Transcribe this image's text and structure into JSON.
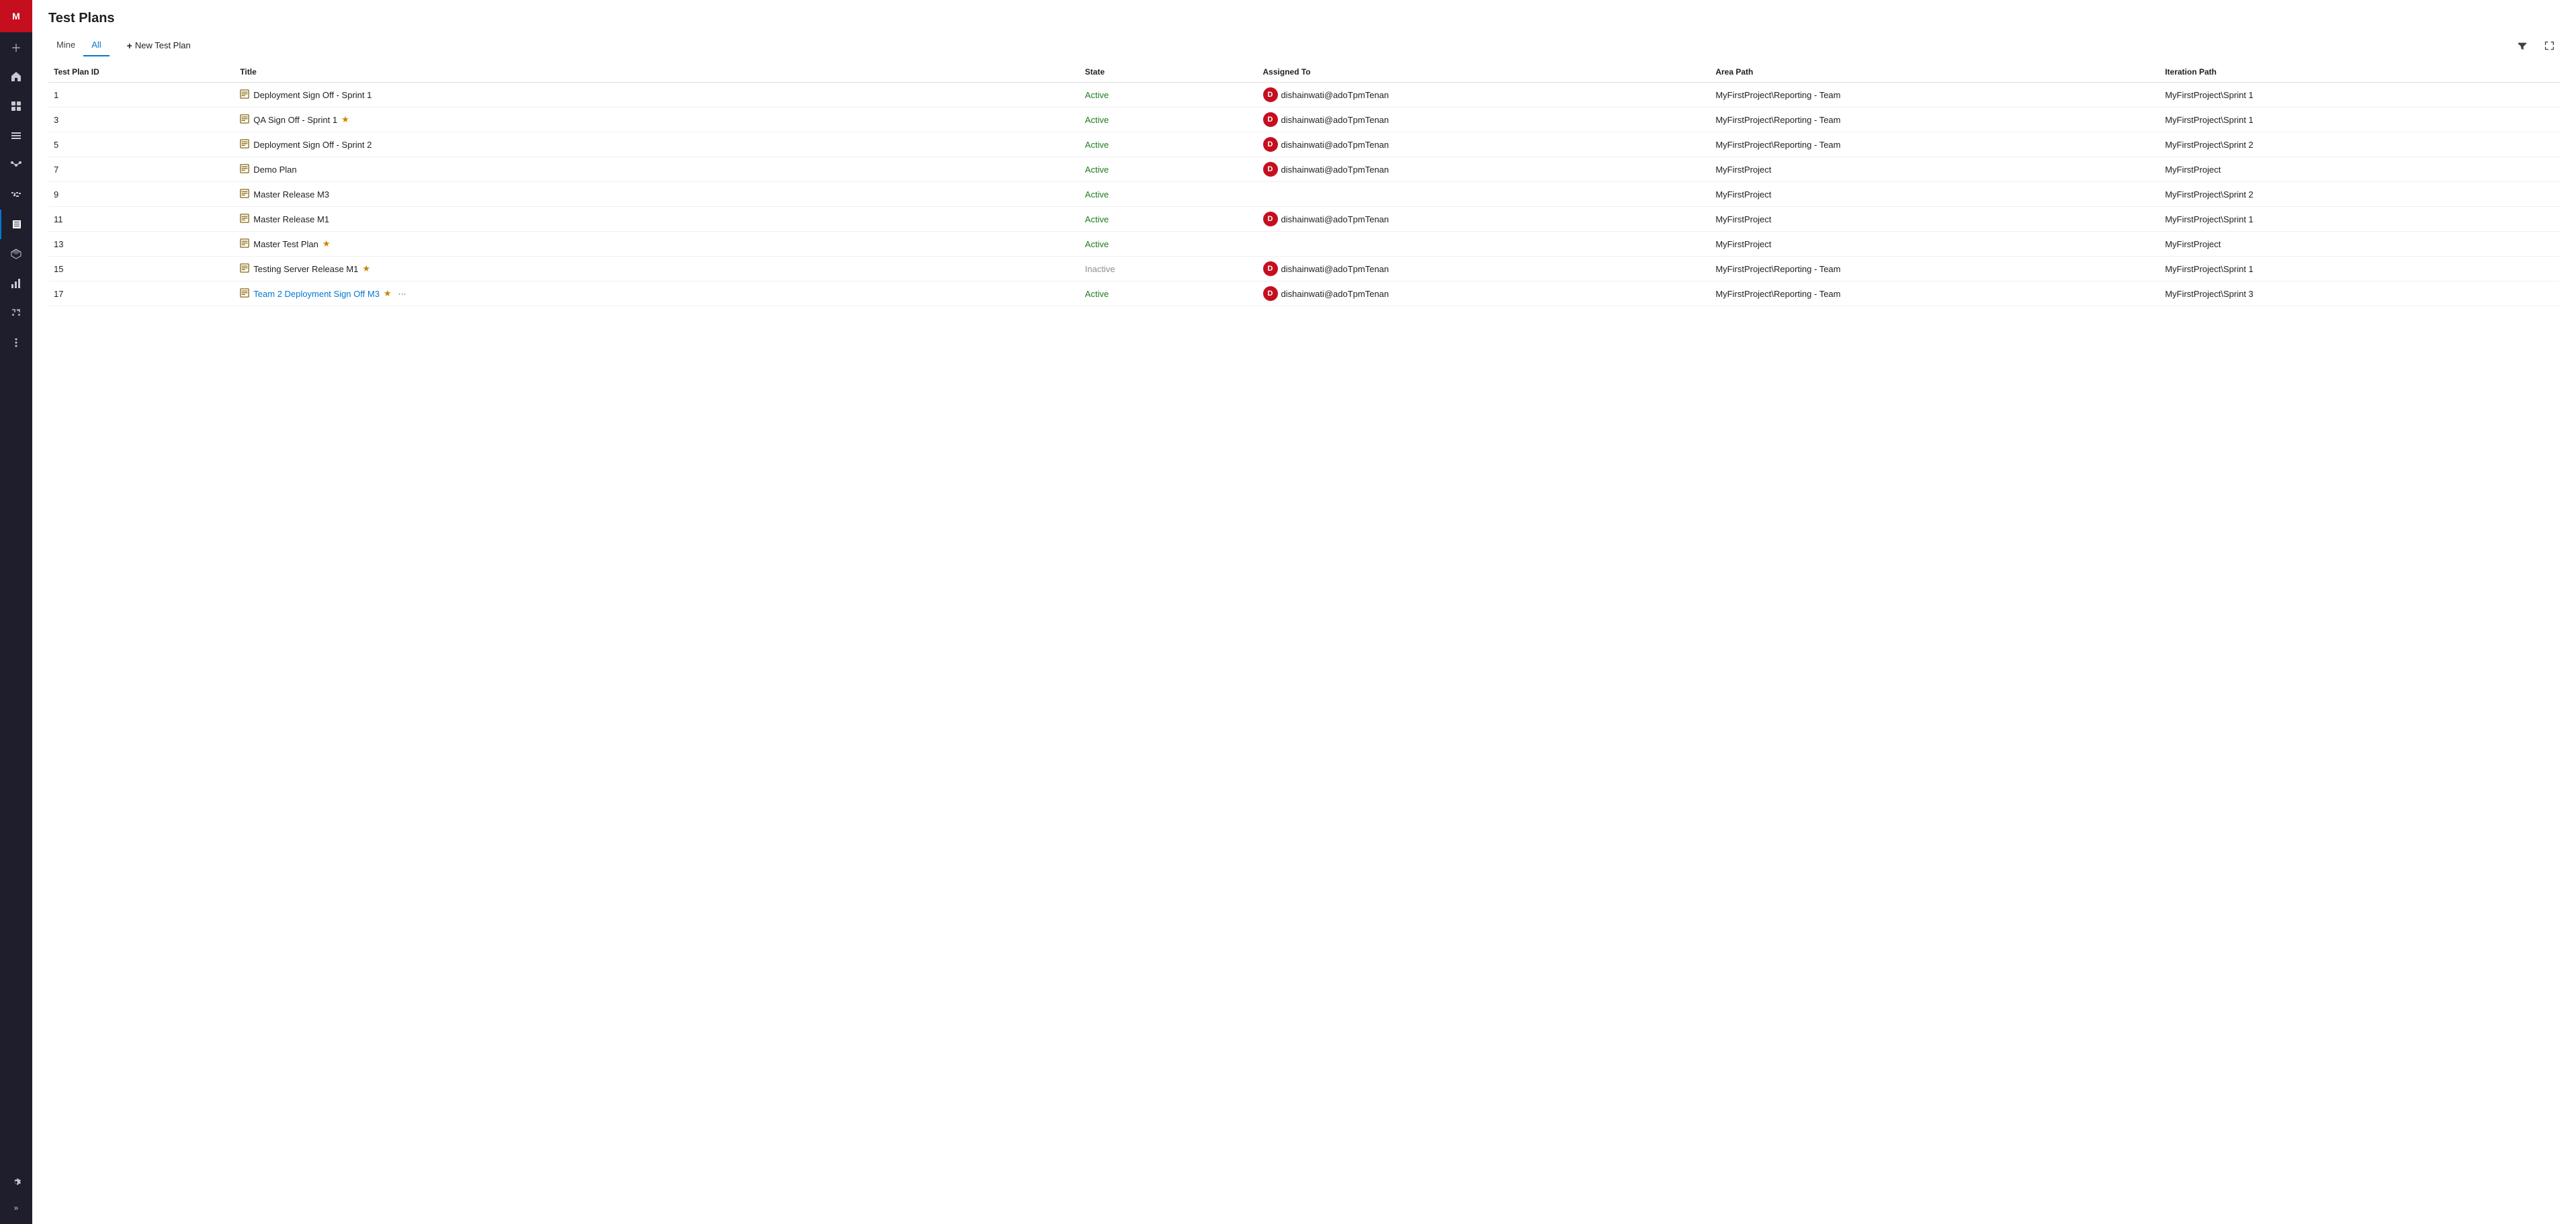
{
  "sidebar": {
    "avatar_label": "M",
    "icons": [
      {
        "name": "plus-icon",
        "glyph": "+",
        "active": false
      },
      {
        "name": "home-icon",
        "glyph": "⌂",
        "active": false
      },
      {
        "name": "boards-icon",
        "glyph": "▦",
        "active": false
      },
      {
        "name": "backlogs-icon",
        "glyph": "≡",
        "active": false
      },
      {
        "name": "repos-icon",
        "glyph": "⑂",
        "active": false
      },
      {
        "name": "pipelines-icon",
        "glyph": "▷",
        "active": false
      },
      {
        "name": "testplans-icon",
        "glyph": "✓",
        "active": true
      },
      {
        "name": "artifacts-icon",
        "glyph": "⬡",
        "active": false
      },
      {
        "name": "analytics-icon",
        "glyph": "📊",
        "active": false
      },
      {
        "name": "extensions-icon",
        "glyph": "⊞",
        "active": false
      },
      {
        "name": "settings2-icon",
        "glyph": "⚙",
        "active": false
      }
    ],
    "bottom_icons": [
      {
        "name": "settings-icon",
        "glyph": "⚙"
      },
      {
        "name": "expand-icon",
        "glyph": "»"
      }
    ]
  },
  "page": {
    "title": "Test Plans",
    "tabs": [
      {
        "label": "Mine",
        "id": "mine",
        "active": false
      },
      {
        "label": "All",
        "id": "all",
        "active": true
      }
    ],
    "new_plan_label": "New Test Plan",
    "columns": {
      "id": "Test Plan ID",
      "title": "Title",
      "state": "State",
      "assigned_to": "Assigned To",
      "area_path": "Area Path",
      "iteration_path": "Iteration Path"
    },
    "rows": [
      {
        "id": "1",
        "title": "Deployment Sign Off - Sprint 1",
        "is_link": false,
        "starred": false,
        "state": "Active",
        "state_class": "state-active",
        "assigned_avatar": "D",
        "assigned_name": "dishainwati@adoTpmTenan",
        "area_path": "MyFirstProject\\Reporting - Team",
        "iteration_path": "MyFirstProject\\Sprint 1",
        "show_more": false
      },
      {
        "id": "3",
        "title": "QA Sign Off - Sprint 1",
        "is_link": false,
        "starred": true,
        "state": "Active",
        "state_class": "state-active",
        "assigned_avatar": "D",
        "assigned_name": "dishainwati@adoTpmTenan",
        "area_path": "MyFirstProject\\Reporting - Team",
        "iteration_path": "MyFirstProject\\Sprint 1",
        "show_more": false
      },
      {
        "id": "5",
        "title": "Deployment Sign Off - Sprint 2",
        "is_link": false,
        "starred": false,
        "state": "Active",
        "state_class": "state-active",
        "assigned_avatar": "D",
        "assigned_name": "dishainwati@adoTpmTenan",
        "area_path": "MyFirstProject\\Reporting - Team",
        "iteration_path": "MyFirstProject\\Sprint 2",
        "show_more": false
      },
      {
        "id": "7",
        "title": "Demo Plan",
        "is_link": false,
        "starred": false,
        "state": "Active",
        "state_class": "state-active",
        "assigned_avatar": "D",
        "assigned_name": "dishainwati@adoTpmTenan",
        "area_path": "MyFirstProject",
        "iteration_path": "MyFirstProject",
        "show_more": false
      },
      {
        "id": "9",
        "title": "Master Release M3",
        "is_link": false,
        "starred": false,
        "state": "Active",
        "state_class": "state-active",
        "assigned_avatar": "",
        "assigned_name": "",
        "area_path": "MyFirstProject",
        "iteration_path": "MyFirstProject\\Sprint 2",
        "show_more": false
      },
      {
        "id": "11",
        "title": "Master Release M1",
        "is_link": false,
        "starred": false,
        "state": "Active",
        "state_class": "state-active",
        "assigned_avatar": "D",
        "assigned_name": "dishainwati@adoTpmTenan",
        "area_path": "MyFirstProject",
        "iteration_path": "MyFirstProject\\Sprint 1",
        "show_more": false
      },
      {
        "id": "13",
        "title": "Master Test Plan",
        "is_link": false,
        "starred": true,
        "state": "Active",
        "state_class": "state-active",
        "assigned_avatar": "",
        "assigned_name": "",
        "area_path": "MyFirstProject",
        "iteration_path": "MyFirstProject",
        "show_more": false
      },
      {
        "id": "15",
        "title": "Testing Server Release M1",
        "is_link": false,
        "starred": true,
        "state": "Inactive",
        "state_class": "state-inactive",
        "assigned_avatar": "D",
        "assigned_name": "dishainwati@adoTpmTenan",
        "area_path": "MyFirstProject\\Reporting - Team",
        "iteration_path": "MyFirstProject\\Sprint 1",
        "show_more": false
      },
      {
        "id": "17",
        "title": "Team 2 Deployment Sign Off M3",
        "is_link": true,
        "starred": true,
        "state": "Active",
        "state_class": "state-active",
        "assigned_avatar": "D",
        "assigned_name": "dishainwati@adoTpmTenan",
        "area_path": "MyFirstProject\\Reporting - Team",
        "iteration_path": "MyFirstProject\\Sprint 3",
        "show_more": true
      }
    ]
  }
}
